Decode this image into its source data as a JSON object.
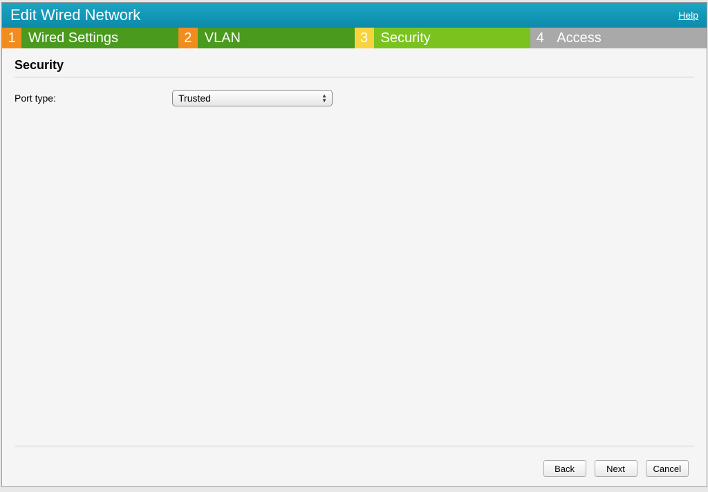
{
  "title": "Edit Wired Network",
  "help_label": "Help",
  "tabs": [
    {
      "num": "1",
      "label": "Wired Settings"
    },
    {
      "num": "2",
      "label": "VLAN"
    },
    {
      "num": "3",
      "label": "Security"
    },
    {
      "num": "4",
      "label": "Access"
    }
  ],
  "section": {
    "heading": "Security",
    "port_type_label": "Port type:",
    "port_type_value": "Trusted"
  },
  "buttons": {
    "back": "Back",
    "next": "Next",
    "cancel": "Cancel"
  }
}
